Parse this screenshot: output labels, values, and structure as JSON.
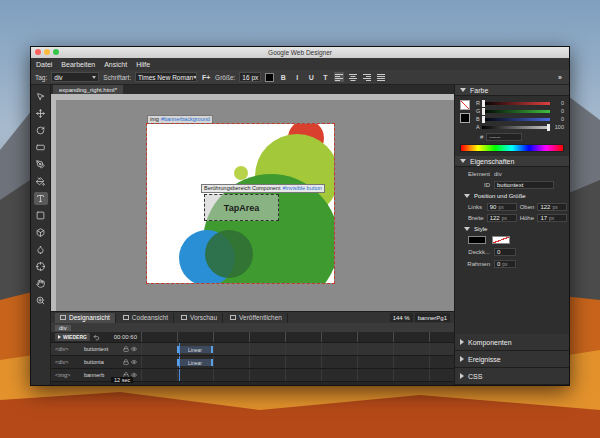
{
  "window": {
    "title": "Google Web Designer"
  },
  "menu": [
    "Datei",
    "Bearbeiten",
    "Ansicht",
    "Hilfe"
  ],
  "toolbar": {
    "tag_label": "Tag:",
    "tag_value": "div",
    "font_label": "Schriftart:",
    "font_value": "Times New Roman",
    "font_button": "F+",
    "size_label": "Größe:",
    "size_value": "16 px",
    "format_buttons": [
      {
        "label": "B",
        "selected": false
      },
      {
        "label": "I",
        "selected": false
      },
      {
        "label": "U",
        "selected": false
      },
      {
        "label": "T",
        "selected": false
      }
    ],
    "align_buttons": [
      {
        "kind": "left",
        "selected": true
      },
      {
        "kind": "center",
        "selected": false
      },
      {
        "kind": "right",
        "selected": false
      },
      {
        "kind": "justify",
        "selected": false
      }
    ],
    "expand": "»"
  },
  "tools": [
    {
      "kind": "select",
      "selected": false
    },
    {
      "kind": "transform",
      "selected": false
    },
    {
      "kind": "rotate",
      "selected": false
    },
    {
      "kind": "tag",
      "selected": false
    },
    {
      "kind": "pen",
      "selected": false
    },
    {
      "kind": "fill",
      "selected": false
    },
    {
      "kind": "text",
      "selected": true
    },
    {
      "kind": "shape",
      "selected": false
    },
    {
      "kind": "box",
      "selected": false
    },
    {
      "kind": "droplet",
      "selected": false
    },
    {
      "kind": "translate",
      "selected": false
    },
    {
      "kind": "hand",
      "selected": false
    },
    {
      "kind": "zoom",
      "selected": false
    }
  ],
  "document_tab": {
    "label": "expanding_right.html*"
  },
  "canvas": {
    "image_label": {
      "tag": "img",
      "id": "#bannerbackground"
    },
    "component_label": {
      "name": "Berührungsbereich Component",
      "id": "#invisible button"
    },
    "tap_area": "TapArea"
  },
  "view_tabs": [
    {
      "label": "Designansicht",
      "selected": true
    },
    {
      "label": "Codeansicht",
      "selected": false
    },
    {
      "label": "Vorschau",
      "selected": false
    },
    {
      "label": "Veröffentlichen",
      "selected": false
    }
  ],
  "zoom": "144 %",
  "page": "bannerPg1",
  "timeline": {
    "breadcrumb": "div",
    "play_label": "WIEDERG",
    "time": "00:00:60",
    "tooltip": "12 sec",
    "rows": [
      {
        "tag": "<div>",
        "name": "buttontext",
        "bar": "Linear",
        "selected": true
      },
      {
        "tag": "<div>",
        "name": "buttonta",
        "bar": "Linear",
        "selected": false
      },
      {
        "tag": "<img>",
        "name": "bannerb",
        "bar": "",
        "selected": false
      }
    ]
  },
  "color_panel": {
    "title": "Farbe",
    "expanded": true,
    "channels": [
      {
        "label": "R",
        "value": "0",
        "level": 0,
        "color": "#e04040"
      },
      {
        "label": "G",
        "value": "0",
        "level": 0,
        "color": "#40c040"
      },
      {
        "label": "B",
        "value": "0",
        "level": 0,
        "color": "#4a6ae0"
      },
      {
        "label": "A",
        "value": "100",
        "level": 1,
        "color": "#cccccc"
      }
    ],
    "hex_label": "#",
    "hex_value": "------"
  },
  "properties": {
    "title": "Eigenschaften",
    "expanded": true,
    "element_label": "Element",
    "element_value": "div",
    "id_label": "ID",
    "id_value": "buttontext",
    "position_section": {
      "title": "Position und Größe",
      "expanded": true,
      "fields": [
        {
          "label": "Links",
          "value": "90",
          "unit": "px"
        },
        {
          "label": "Oben",
          "value": "122",
          "unit": "px"
        },
        {
          "label": "Breite",
          "value": "122",
          "unit": "px"
        },
        {
          "label": "Höhe",
          "value": "17",
          "unit": "px"
        }
      ]
    },
    "style_section": {
      "title": "Style",
      "expanded": true,
      "opacity_label": "Deckk...",
      "opacity_value": "0",
      "border_label": "Rahmen",
      "border_value": "0",
      "border_unit": "px"
    }
  },
  "collapsed_panels": [
    {
      "title": "Komponenten",
      "expanded": false
    },
    {
      "title": "Ereignisse",
      "expanded": false
    },
    {
      "title": "CSS",
      "expanded": false
    }
  ]
}
